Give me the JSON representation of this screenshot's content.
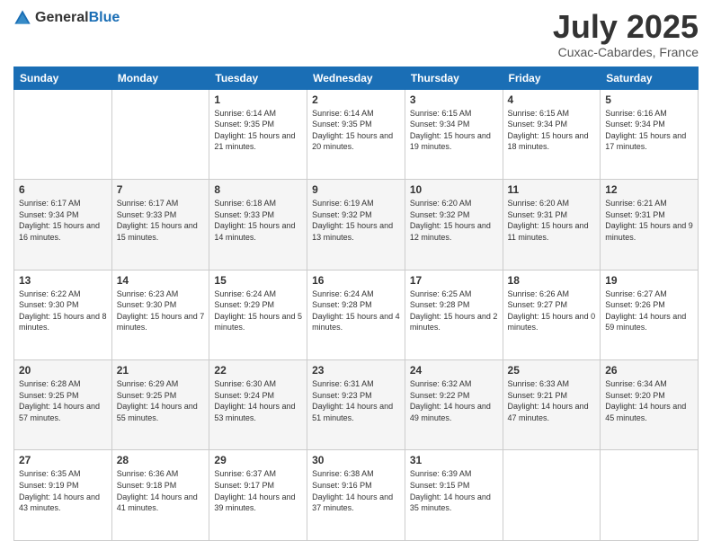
{
  "header": {
    "logo": {
      "general": "General",
      "blue": "Blue"
    },
    "month": "July 2025",
    "location": "Cuxac-Cabardes, France"
  },
  "days_header": [
    "Sunday",
    "Monday",
    "Tuesday",
    "Wednesday",
    "Thursday",
    "Friday",
    "Saturday"
  ],
  "weeks": [
    [
      {
        "day": "",
        "info": ""
      },
      {
        "day": "",
        "info": ""
      },
      {
        "day": "1",
        "info": "Sunrise: 6:14 AM\nSunset: 9:35 PM\nDaylight: 15 hours and 21 minutes."
      },
      {
        "day": "2",
        "info": "Sunrise: 6:14 AM\nSunset: 9:35 PM\nDaylight: 15 hours and 20 minutes."
      },
      {
        "day": "3",
        "info": "Sunrise: 6:15 AM\nSunset: 9:34 PM\nDaylight: 15 hours and 19 minutes."
      },
      {
        "day": "4",
        "info": "Sunrise: 6:15 AM\nSunset: 9:34 PM\nDaylight: 15 hours and 18 minutes."
      },
      {
        "day": "5",
        "info": "Sunrise: 6:16 AM\nSunset: 9:34 PM\nDaylight: 15 hours and 17 minutes."
      }
    ],
    [
      {
        "day": "6",
        "info": "Sunrise: 6:17 AM\nSunset: 9:34 PM\nDaylight: 15 hours and 16 minutes."
      },
      {
        "day": "7",
        "info": "Sunrise: 6:17 AM\nSunset: 9:33 PM\nDaylight: 15 hours and 15 minutes."
      },
      {
        "day": "8",
        "info": "Sunrise: 6:18 AM\nSunset: 9:33 PM\nDaylight: 15 hours and 14 minutes."
      },
      {
        "day": "9",
        "info": "Sunrise: 6:19 AM\nSunset: 9:32 PM\nDaylight: 15 hours and 13 minutes."
      },
      {
        "day": "10",
        "info": "Sunrise: 6:20 AM\nSunset: 9:32 PM\nDaylight: 15 hours and 12 minutes."
      },
      {
        "day": "11",
        "info": "Sunrise: 6:20 AM\nSunset: 9:31 PM\nDaylight: 15 hours and 11 minutes."
      },
      {
        "day": "12",
        "info": "Sunrise: 6:21 AM\nSunset: 9:31 PM\nDaylight: 15 hours and 9 minutes."
      }
    ],
    [
      {
        "day": "13",
        "info": "Sunrise: 6:22 AM\nSunset: 9:30 PM\nDaylight: 15 hours and 8 minutes."
      },
      {
        "day": "14",
        "info": "Sunrise: 6:23 AM\nSunset: 9:30 PM\nDaylight: 15 hours and 7 minutes."
      },
      {
        "day": "15",
        "info": "Sunrise: 6:24 AM\nSunset: 9:29 PM\nDaylight: 15 hours and 5 minutes."
      },
      {
        "day": "16",
        "info": "Sunrise: 6:24 AM\nSunset: 9:28 PM\nDaylight: 15 hours and 4 minutes."
      },
      {
        "day": "17",
        "info": "Sunrise: 6:25 AM\nSunset: 9:28 PM\nDaylight: 15 hours and 2 minutes."
      },
      {
        "day": "18",
        "info": "Sunrise: 6:26 AM\nSunset: 9:27 PM\nDaylight: 15 hours and 0 minutes."
      },
      {
        "day": "19",
        "info": "Sunrise: 6:27 AM\nSunset: 9:26 PM\nDaylight: 14 hours and 59 minutes."
      }
    ],
    [
      {
        "day": "20",
        "info": "Sunrise: 6:28 AM\nSunset: 9:25 PM\nDaylight: 14 hours and 57 minutes."
      },
      {
        "day": "21",
        "info": "Sunrise: 6:29 AM\nSunset: 9:25 PM\nDaylight: 14 hours and 55 minutes."
      },
      {
        "day": "22",
        "info": "Sunrise: 6:30 AM\nSunset: 9:24 PM\nDaylight: 14 hours and 53 minutes."
      },
      {
        "day": "23",
        "info": "Sunrise: 6:31 AM\nSunset: 9:23 PM\nDaylight: 14 hours and 51 minutes."
      },
      {
        "day": "24",
        "info": "Sunrise: 6:32 AM\nSunset: 9:22 PM\nDaylight: 14 hours and 49 minutes."
      },
      {
        "day": "25",
        "info": "Sunrise: 6:33 AM\nSunset: 9:21 PM\nDaylight: 14 hours and 47 minutes."
      },
      {
        "day": "26",
        "info": "Sunrise: 6:34 AM\nSunset: 9:20 PM\nDaylight: 14 hours and 45 minutes."
      }
    ],
    [
      {
        "day": "27",
        "info": "Sunrise: 6:35 AM\nSunset: 9:19 PM\nDaylight: 14 hours and 43 minutes."
      },
      {
        "day": "28",
        "info": "Sunrise: 6:36 AM\nSunset: 9:18 PM\nDaylight: 14 hours and 41 minutes."
      },
      {
        "day": "29",
        "info": "Sunrise: 6:37 AM\nSunset: 9:17 PM\nDaylight: 14 hours and 39 minutes."
      },
      {
        "day": "30",
        "info": "Sunrise: 6:38 AM\nSunset: 9:16 PM\nDaylight: 14 hours and 37 minutes."
      },
      {
        "day": "31",
        "info": "Sunrise: 6:39 AM\nSunset: 9:15 PM\nDaylight: 14 hours and 35 minutes."
      },
      {
        "day": "",
        "info": ""
      },
      {
        "day": "",
        "info": ""
      }
    ]
  ]
}
